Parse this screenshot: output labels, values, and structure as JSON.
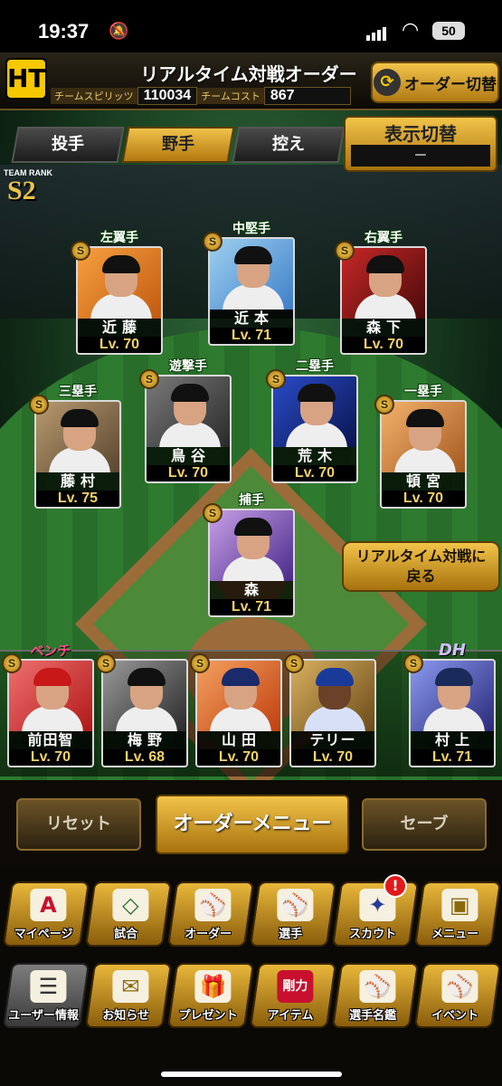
{
  "status": {
    "time": "19:37",
    "battery": "50"
  },
  "header": {
    "title": "リアルタイム対戦オーダー",
    "logo_text": "HT",
    "team_spirits_label": "チームスピリッツ",
    "team_spirits_value": "110034",
    "team_cost_label": "チームコスト",
    "team_cost_value": "867",
    "order_switch_label": "オーダー切替"
  },
  "tabs": [
    {
      "label": "投手",
      "active": false
    },
    {
      "label": "野手",
      "active": true
    },
    {
      "label": "控え",
      "active": false
    }
  ],
  "display_toggle": {
    "label": "表示切替",
    "value": "－"
  },
  "team_rank": {
    "label": "TEAM RANK",
    "value": "S2"
  },
  "lineup": [
    {
      "position": "左翼手",
      "name": "近藤",
      "level": "Lv. 70",
      "badge": "S"
    },
    {
      "position": "中堅手",
      "name": "近本",
      "level": "Lv. 71",
      "badge": "S"
    },
    {
      "position": "右翼手",
      "name": "森下",
      "level": "Lv. 70",
      "badge": "S"
    },
    {
      "position": "遊撃手",
      "name": "鳥谷",
      "level": "Lv. 70",
      "badge": "S"
    },
    {
      "position": "二塁手",
      "name": "荒木",
      "level": "Lv. 70",
      "badge": "S"
    },
    {
      "position": "三塁手",
      "name": "藤村",
      "level": "Lv. 75",
      "badge": "S"
    },
    {
      "position": "一塁手",
      "name": "頓宮",
      "level": "Lv. 70",
      "badge": "S"
    },
    {
      "position": "捕手",
      "name": "森",
      "level": "Lv. 71",
      "badge": "S"
    }
  ],
  "return_button": {
    "line1": "リアルタイム対戦に",
    "line2": "戻る"
  },
  "bench_label": "ベンチ",
  "dh_label": "DH",
  "bench": [
    {
      "name": "前田智",
      "level": "Lv. 70",
      "badge": "S"
    },
    {
      "name": "梅野",
      "level": "Lv. 68",
      "badge": "S"
    },
    {
      "name": "山田",
      "level": "Lv. 70",
      "badge": "S"
    },
    {
      "name": "テリー",
      "level": "Lv. 70",
      "badge": "S"
    },
    {
      "name": "村上",
      "level": "Lv. 71",
      "badge": "S"
    }
  ],
  "actions": {
    "reset": "リセット",
    "order_menu": "オーダーメニュー",
    "save": "セーブ"
  },
  "nav_row1": [
    {
      "label": "マイページ",
      "icon": "A"
    },
    {
      "label": "試合",
      "icon": "◇"
    },
    {
      "label": "オーダー",
      "icon": "⚾"
    },
    {
      "label": "選手",
      "icon": "⚾"
    },
    {
      "label": "スカウト",
      "icon": "✦"
    },
    {
      "label": "メニュー",
      "icon": "▣"
    }
  ],
  "nav_row2": [
    {
      "label": "ユーザー情報",
      "icon": "☰"
    },
    {
      "label": "お知らせ",
      "icon": "✉"
    },
    {
      "label": "プレゼント",
      "icon": "🎁"
    },
    {
      "label": "アイテム",
      "icon": "剛力"
    },
    {
      "label": "選手名鑑",
      "icon": "⚾"
    },
    {
      "label": "イベント",
      "icon": "⚾"
    }
  ],
  "scout_notification": "!"
}
